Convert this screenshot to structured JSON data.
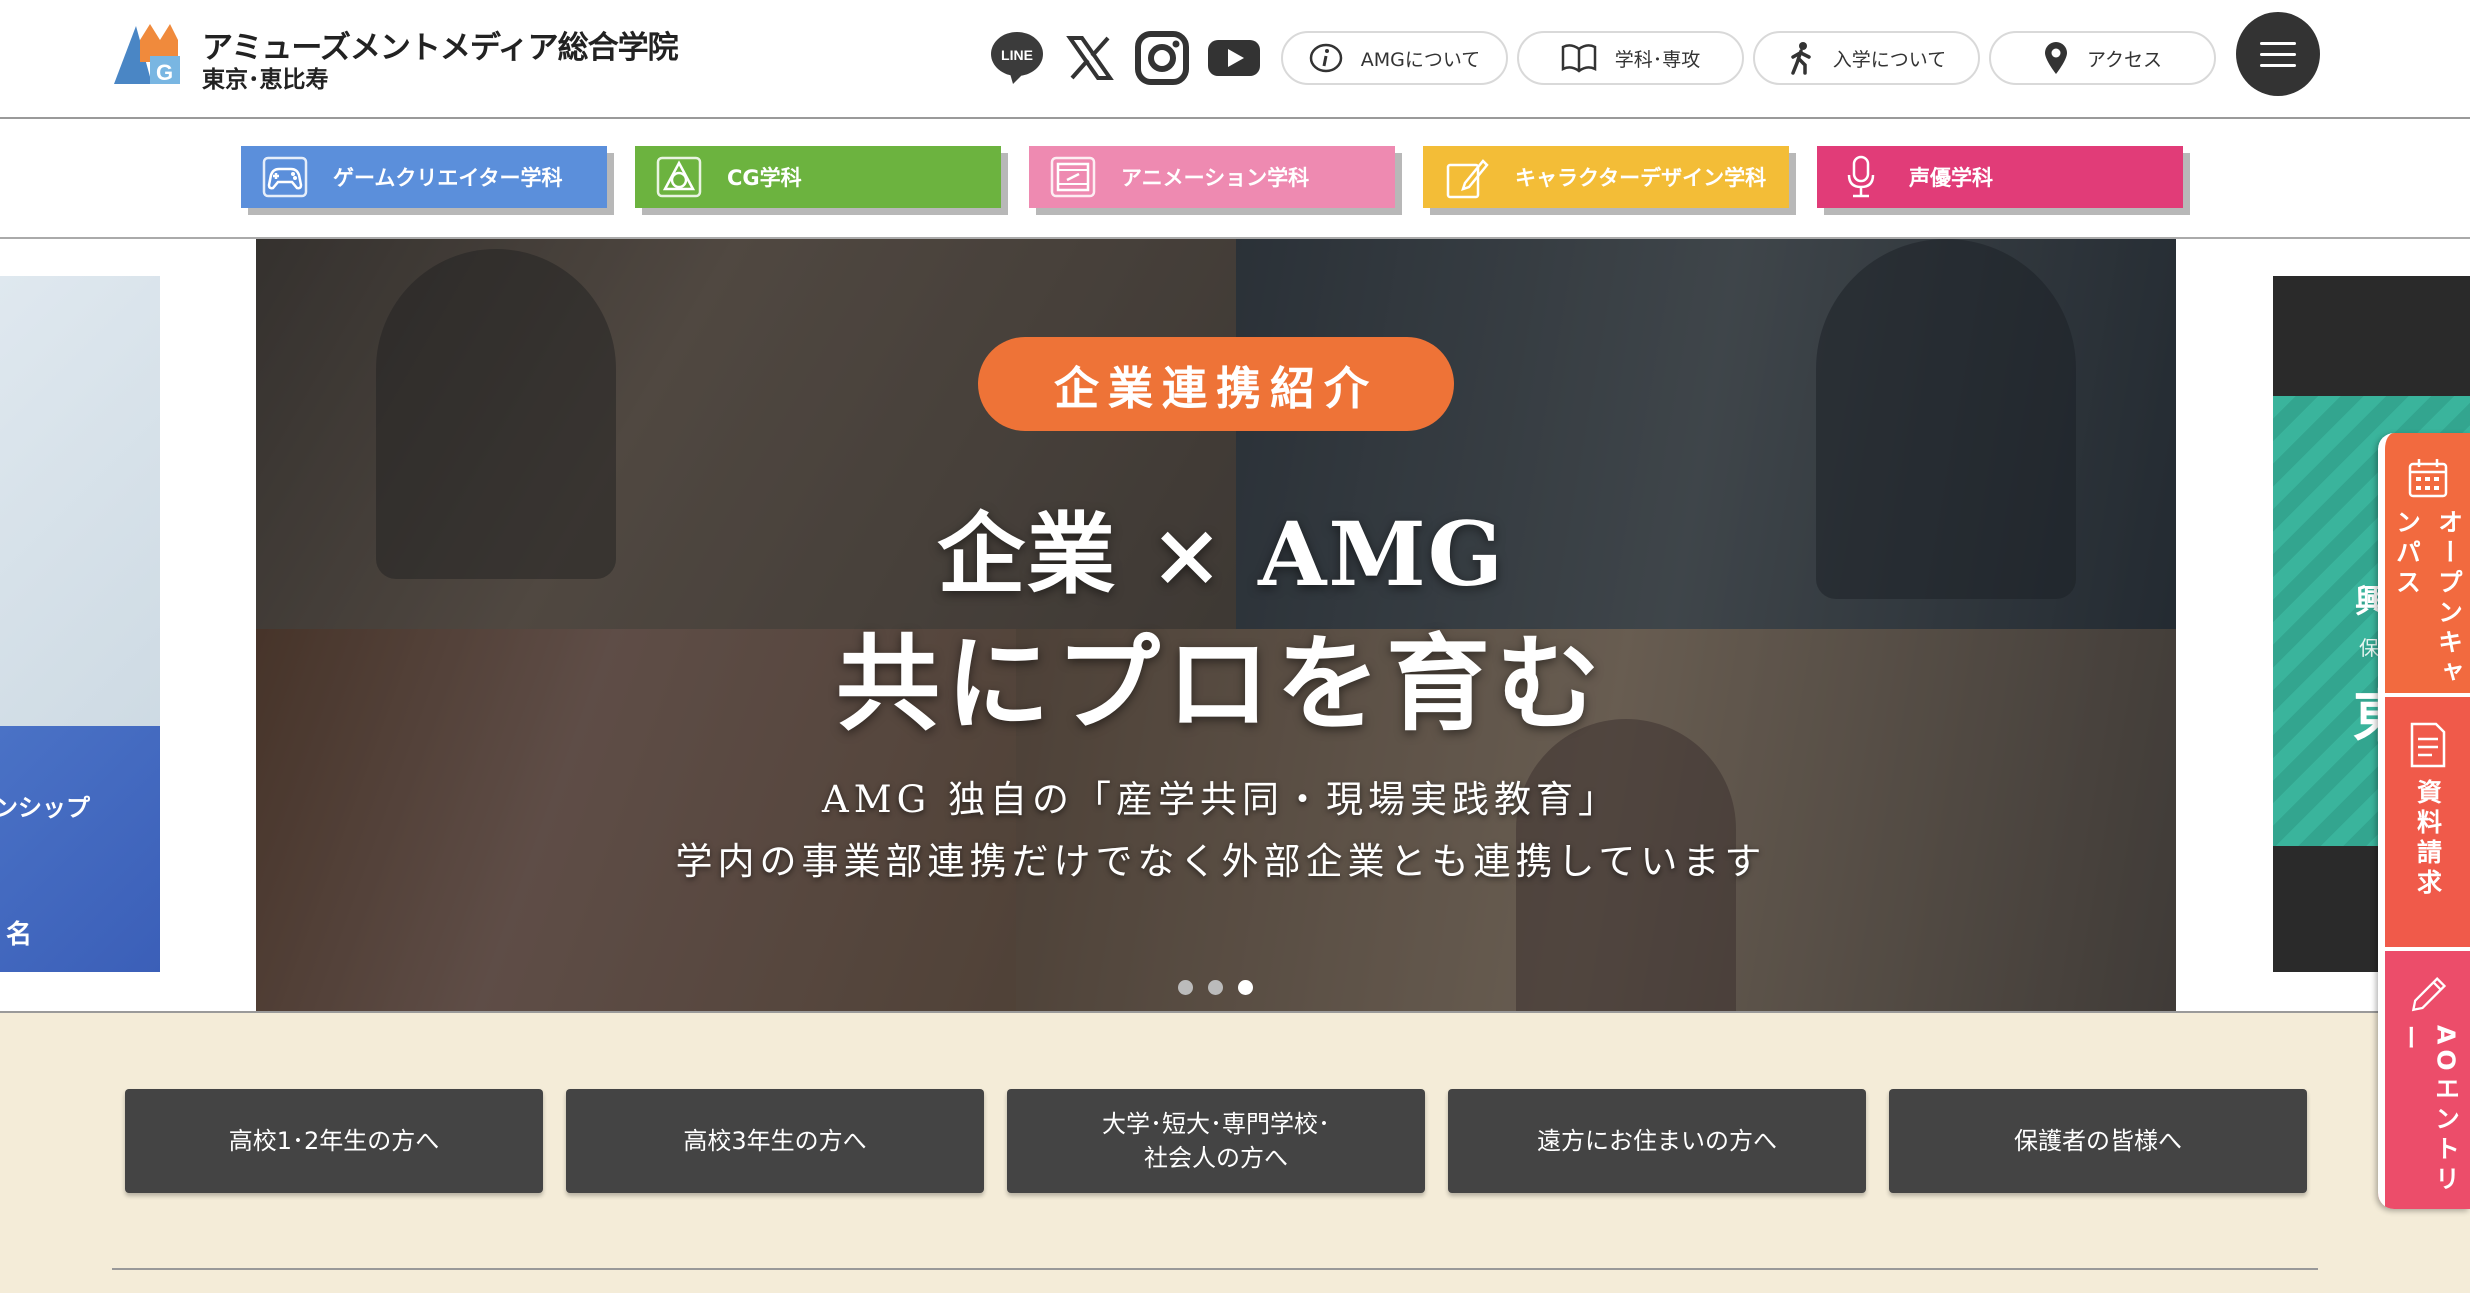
{
  "header": {
    "logo_title": "アミューズメントメディア総合学院",
    "logo_sub": "東京･恵比寿",
    "social": [
      "line-icon",
      "x-icon",
      "instagram-icon",
      "youtube-icon"
    ],
    "line_label": "LINE",
    "pills": [
      {
        "label": "AMGについて",
        "icon": "info-icon"
      },
      {
        "label": "学科･専攻",
        "icon": "book-icon"
      },
      {
        "label": "入学について",
        "icon": "walking-person-icon"
      },
      {
        "label": "アクセス",
        "icon": "map-pin-icon"
      }
    ]
  },
  "departments": [
    {
      "label": "ゲームクリエイター学科",
      "color": "#5b8fdb",
      "icon": "game-controller-icon"
    },
    {
      "label": "CG学科",
      "color": "#6cb33f",
      "icon": "cg-icon"
    },
    {
      "label": "アニメーション学科",
      "color": "#ee8ab1",
      "icon": "film-icon"
    },
    {
      "label": "キャラクターデザイン学科",
      "color": "#f3bd37",
      "icon": "pen-icon"
    },
    {
      "label": "声優学科",
      "color": "#e13c78",
      "icon": "microphone-icon"
    }
  ],
  "carousel": {
    "badge": "企業連携紹介",
    "heading1": "企業 × AMG",
    "heading2": "共にプロを育む",
    "body1": "AMG 独自の「産学共同・現場実践教育」",
    "body2": "学内の事業部連携だけでなく外部企業とも連携しています",
    "left_peek_text1": "ンシップ",
    "left_peek_text2": "名",
    "right_peek_text1": "興",
    "right_peek_text2": "保",
    "right_peek_text3": "東",
    "dots_total": 3,
    "dots_active": 3
  },
  "target": {
    "buttons": [
      {
        "label": "高校1･2年生の方へ"
      },
      {
        "label": "高校3年生の方へ"
      },
      {
        "label": "大学･短大･専門学校･\n社会人の方へ"
      },
      {
        "label": "遠方にお住まいの方へ"
      },
      {
        "label": "保護者の皆様へ"
      }
    ]
  },
  "side_tabs": [
    {
      "label": "オープンキャンパス",
      "icon": "calendar-icon",
      "color": "#f26a3f"
    },
    {
      "label": "資料請求",
      "icon": "document-icon",
      "color": "#f05a4a"
    },
    {
      "label": "AOエントリー",
      "icon": "pencil-icon",
      "color": "#ec4d6a"
    }
  ],
  "colors": {
    "accent_orange": "#ee7337",
    "target_bg": "#f4ecd8",
    "target_button": "#444444"
  }
}
